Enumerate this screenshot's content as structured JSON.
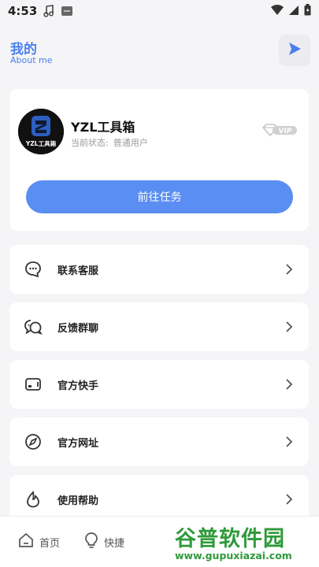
{
  "status_bar": {
    "time": "4:53",
    "icons": [
      "music-note-icon",
      "app-notification-icon",
      "wifi-icon",
      "signal-icon",
      "battery-icon"
    ]
  },
  "header": {
    "title": "我的",
    "subtitle": "About me",
    "action_icon": "play-icon"
  },
  "profile": {
    "avatar_text": "YZL工具箱",
    "username": "YZL工具箱",
    "status_label": "当前状态:",
    "status_value": "普通用户",
    "vip_badge": "VIP",
    "task_button": "前往任务"
  },
  "menu": {
    "items": [
      {
        "label": "联系客服",
        "icon": "chat-bubble-icon"
      },
      {
        "label": "反馈群聊",
        "icon": "group-chat-icon"
      },
      {
        "label": "官方快手",
        "icon": "video-card-icon"
      },
      {
        "label": "官方网址",
        "icon": "compass-icon"
      },
      {
        "label": "使用帮助",
        "icon": "flame-drop-icon"
      }
    ]
  },
  "bottom_nav": {
    "items": [
      {
        "label": "首页",
        "icon": "home-icon"
      },
      {
        "label": "快捷",
        "icon": "lightbulb-icon"
      }
    ]
  },
  "watermark": {
    "text": "谷普软件园",
    "url": "www.gupuxiazai.com"
  },
  "colors": {
    "accent": "#4a7ff0",
    "button": "#5b8ef2",
    "background": "#f5f5f7",
    "watermark": "#2f9a3a"
  }
}
